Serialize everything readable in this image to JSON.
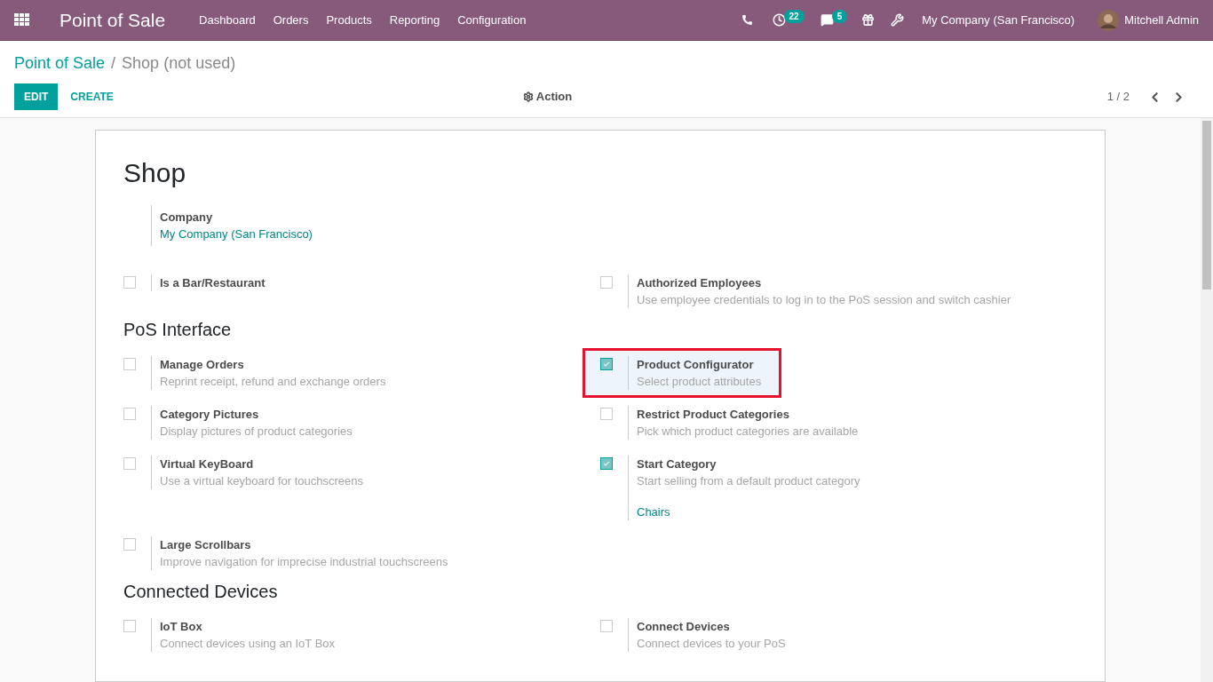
{
  "navbar": {
    "app_title": "Point of Sale",
    "menu": [
      "Dashboard",
      "Orders",
      "Products",
      "Reporting",
      "Configuration"
    ],
    "activity_count": "22",
    "message_count": "5",
    "company": "My Company (San Francisco)",
    "user": "Mitchell Admin"
  },
  "breadcrumb": {
    "parent": "Point of Sale",
    "separator": "/",
    "current": "Shop (not used)"
  },
  "control_panel": {
    "edit": "EDIT",
    "create": "CREATE",
    "action": "Action",
    "pager": "1 / 2"
  },
  "form": {
    "title": "Shop",
    "company": {
      "label": "Company",
      "value": "My Company (San Francisco)"
    },
    "sections": [
      {
        "rows": [
          [
            {
              "label": "Is a Bar/Restaurant",
              "checked": false,
              "highlighted": false
            },
            {
              "label": "Authorized Employees",
              "description": "Use employee credentials to log in to the PoS session and switch cashier",
              "checked": false,
              "highlighted": false
            }
          ]
        ]
      },
      {
        "title": "PoS Interface",
        "rows": [
          [
            {
              "label": "Manage Orders",
              "description": "Reprint receipt, refund and exchange orders",
              "checked": false,
              "highlighted": false
            },
            {
              "label": "Product Configurator",
              "description": "Select product attributes",
              "checked": true,
              "highlighted": true
            }
          ],
          [
            {
              "label": "Category Pictures",
              "description": "Display pictures of product categories",
              "checked": false,
              "highlighted": false
            },
            {
              "label": "Restrict Product Categories",
              "description": "Pick which product categories are available",
              "checked": false,
              "highlighted": false
            }
          ],
          [
            {
              "label": "Virtual KeyBoard",
              "description": "Use a virtual keyboard for touchscreens",
              "checked": false,
              "highlighted": false
            },
            {
              "label": "Start Category",
              "description": "Start selling from a default product category",
              "link": "Chairs",
              "checked": true,
              "highlighted": false
            }
          ],
          [
            {
              "label": "Large Scrollbars",
              "description": "Improve navigation for imprecise industrial touchscreens",
              "checked": false,
              "highlighted": false
            }
          ]
        ]
      },
      {
        "title": "Connected Devices",
        "rows": [
          [
            {
              "label": "IoT Box",
              "description": "Connect devices using an IoT Box",
              "checked": false,
              "highlighted": false
            },
            {
              "label": "Connect Devices",
              "description": "Connect devices to your PoS",
              "checked": false,
              "highlighted": false
            }
          ]
        ]
      }
    ]
  }
}
